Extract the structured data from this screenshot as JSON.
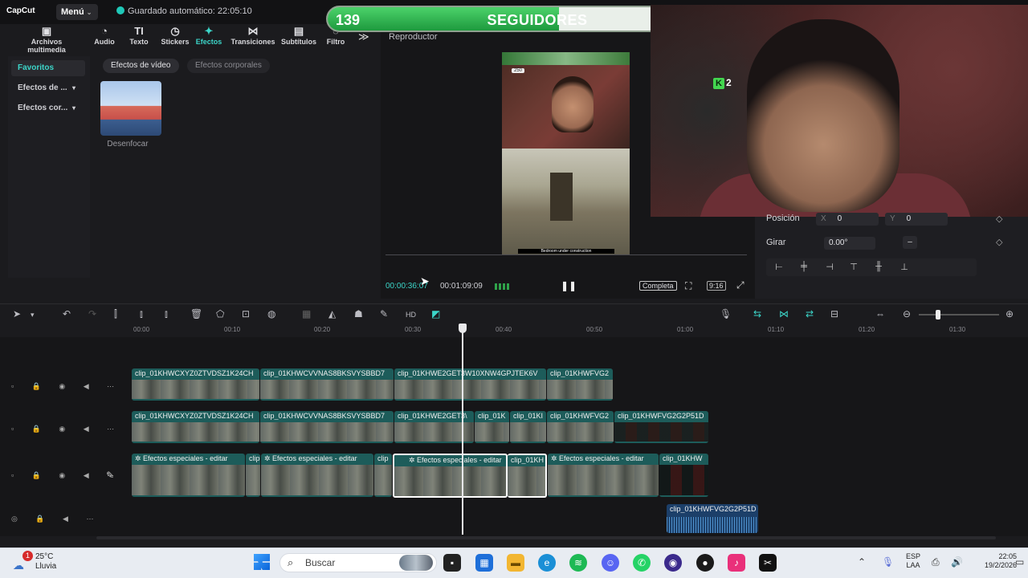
{
  "app": {
    "logo": "CapCut",
    "menu_label": "Menú",
    "autosave": "Guardado automático: 22:05:10"
  },
  "toolbar": {
    "items": [
      {
        "label": "Archivos multimedia",
        "icon": "media-icon"
      },
      {
        "label": "Audio",
        "icon": "audio-icon"
      },
      {
        "label": "Texto",
        "icon": "text-icon"
      },
      {
        "label": "Stickers",
        "icon": "sticker-icon"
      },
      {
        "label": "Efectos",
        "icon": "effects-icon",
        "active": true
      },
      {
        "label": "Transiciones",
        "icon": "transition-icon"
      },
      {
        "label": "Subtítulos",
        "icon": "subtitle-icon"
      },
      {
        "label": "Filtro",
        "icon": "filter-icon"
      }
    ],
    "more": "≫"
  },
  "sidebar": {
    "items": [
      {
        "label": "Favoritos",
        "selected": true
      },
      {
        "label": "Efectos de ..."
      },
      {
        "label": "Efectos cor..."
      }
    ]
  },
  "effects": {
    "tabs": [
      "Efectos de vídeo",
      "Efectos corporales"
    ],
    "item_label": "Desenfocar"
  },
  "player": {
    "title": "Reproductor",
    "badge": "250",
    "caption": "Bedroom under construction",
    "time_current": "00:00:36:07",
    "time_total": "00:01:09:09",
    "play_pause": "❚❚",
    "complete_label": "Completa",
    "ratio": "9:16"
  },
  "followers": {
    "current": "139",
    "label": "SEGUIDORES",
    "goal": "250",
    "progress_fraction": 0.556
  },
  "webcam": {
    "badge_letter": "K",
    "badge_count": "2"
  },
  "properties": {
    "position_label": "Posición",
    "x_label": "X",
    "x_value": "0",
    "y_label": "Y",
    "y_value": "0",
    "rotate_label": "Girar",
    "rotate_value": "0.00°"
  },
  "timeline": {
    "ticks": [
      "00:00",
      "00:10",
      "00:20",
      "00:30",
      "00:40",
      "00:50",
      "01:00",
      "01:10",
      "01:20",
      "01:30"
    ],
    "track1": [
      "clip_01KHWCXYZ0ZTVDSZ1K24CH",
      "clip_01KHWCVVNAS8BKSVYSBBD7",
      "clip_01KHWE2GET3W10XNW4GPJTEK6V",
      "clip_01KHWFVG2"
    ],
    "track2": [
      "clip_01KHWCXYZ0ZTVDSZ1K24CH",
      "clip_01KHWCVVNAS8BKSVYSBBD7",
      "clip_01KHWE2GET3\\",
      "clip_01K",
      "clip_01KI",
      "clip_01KHWFVG2",
      "clip_01KHWFVG2G2P51D"
    ],
    "track3": [
      "✲ Efectos especiales - editar",
      "clip",
      "✲ Efectos especiales - editar",
      "clip",
      "✲ Efectos especiales - editar",
      "clip_01KH",
      "✲ Efectos especiales - editar",
      "clip_01KHW"
    ],
    "audio_clip": "clip_01KHWFVG2G2P51D"
  },
  "taskbar": {
    "weather_temp": "25°C",
    "weather_desc": "Lluvia",
    "weather_badge": "1",
    "search_placeholder": "Buscar",
    "lang_top": "ESP",
    "lang_bottom": "LAA",
    "time": "22:05",
    "date": "19/2/2026"
  }
}
